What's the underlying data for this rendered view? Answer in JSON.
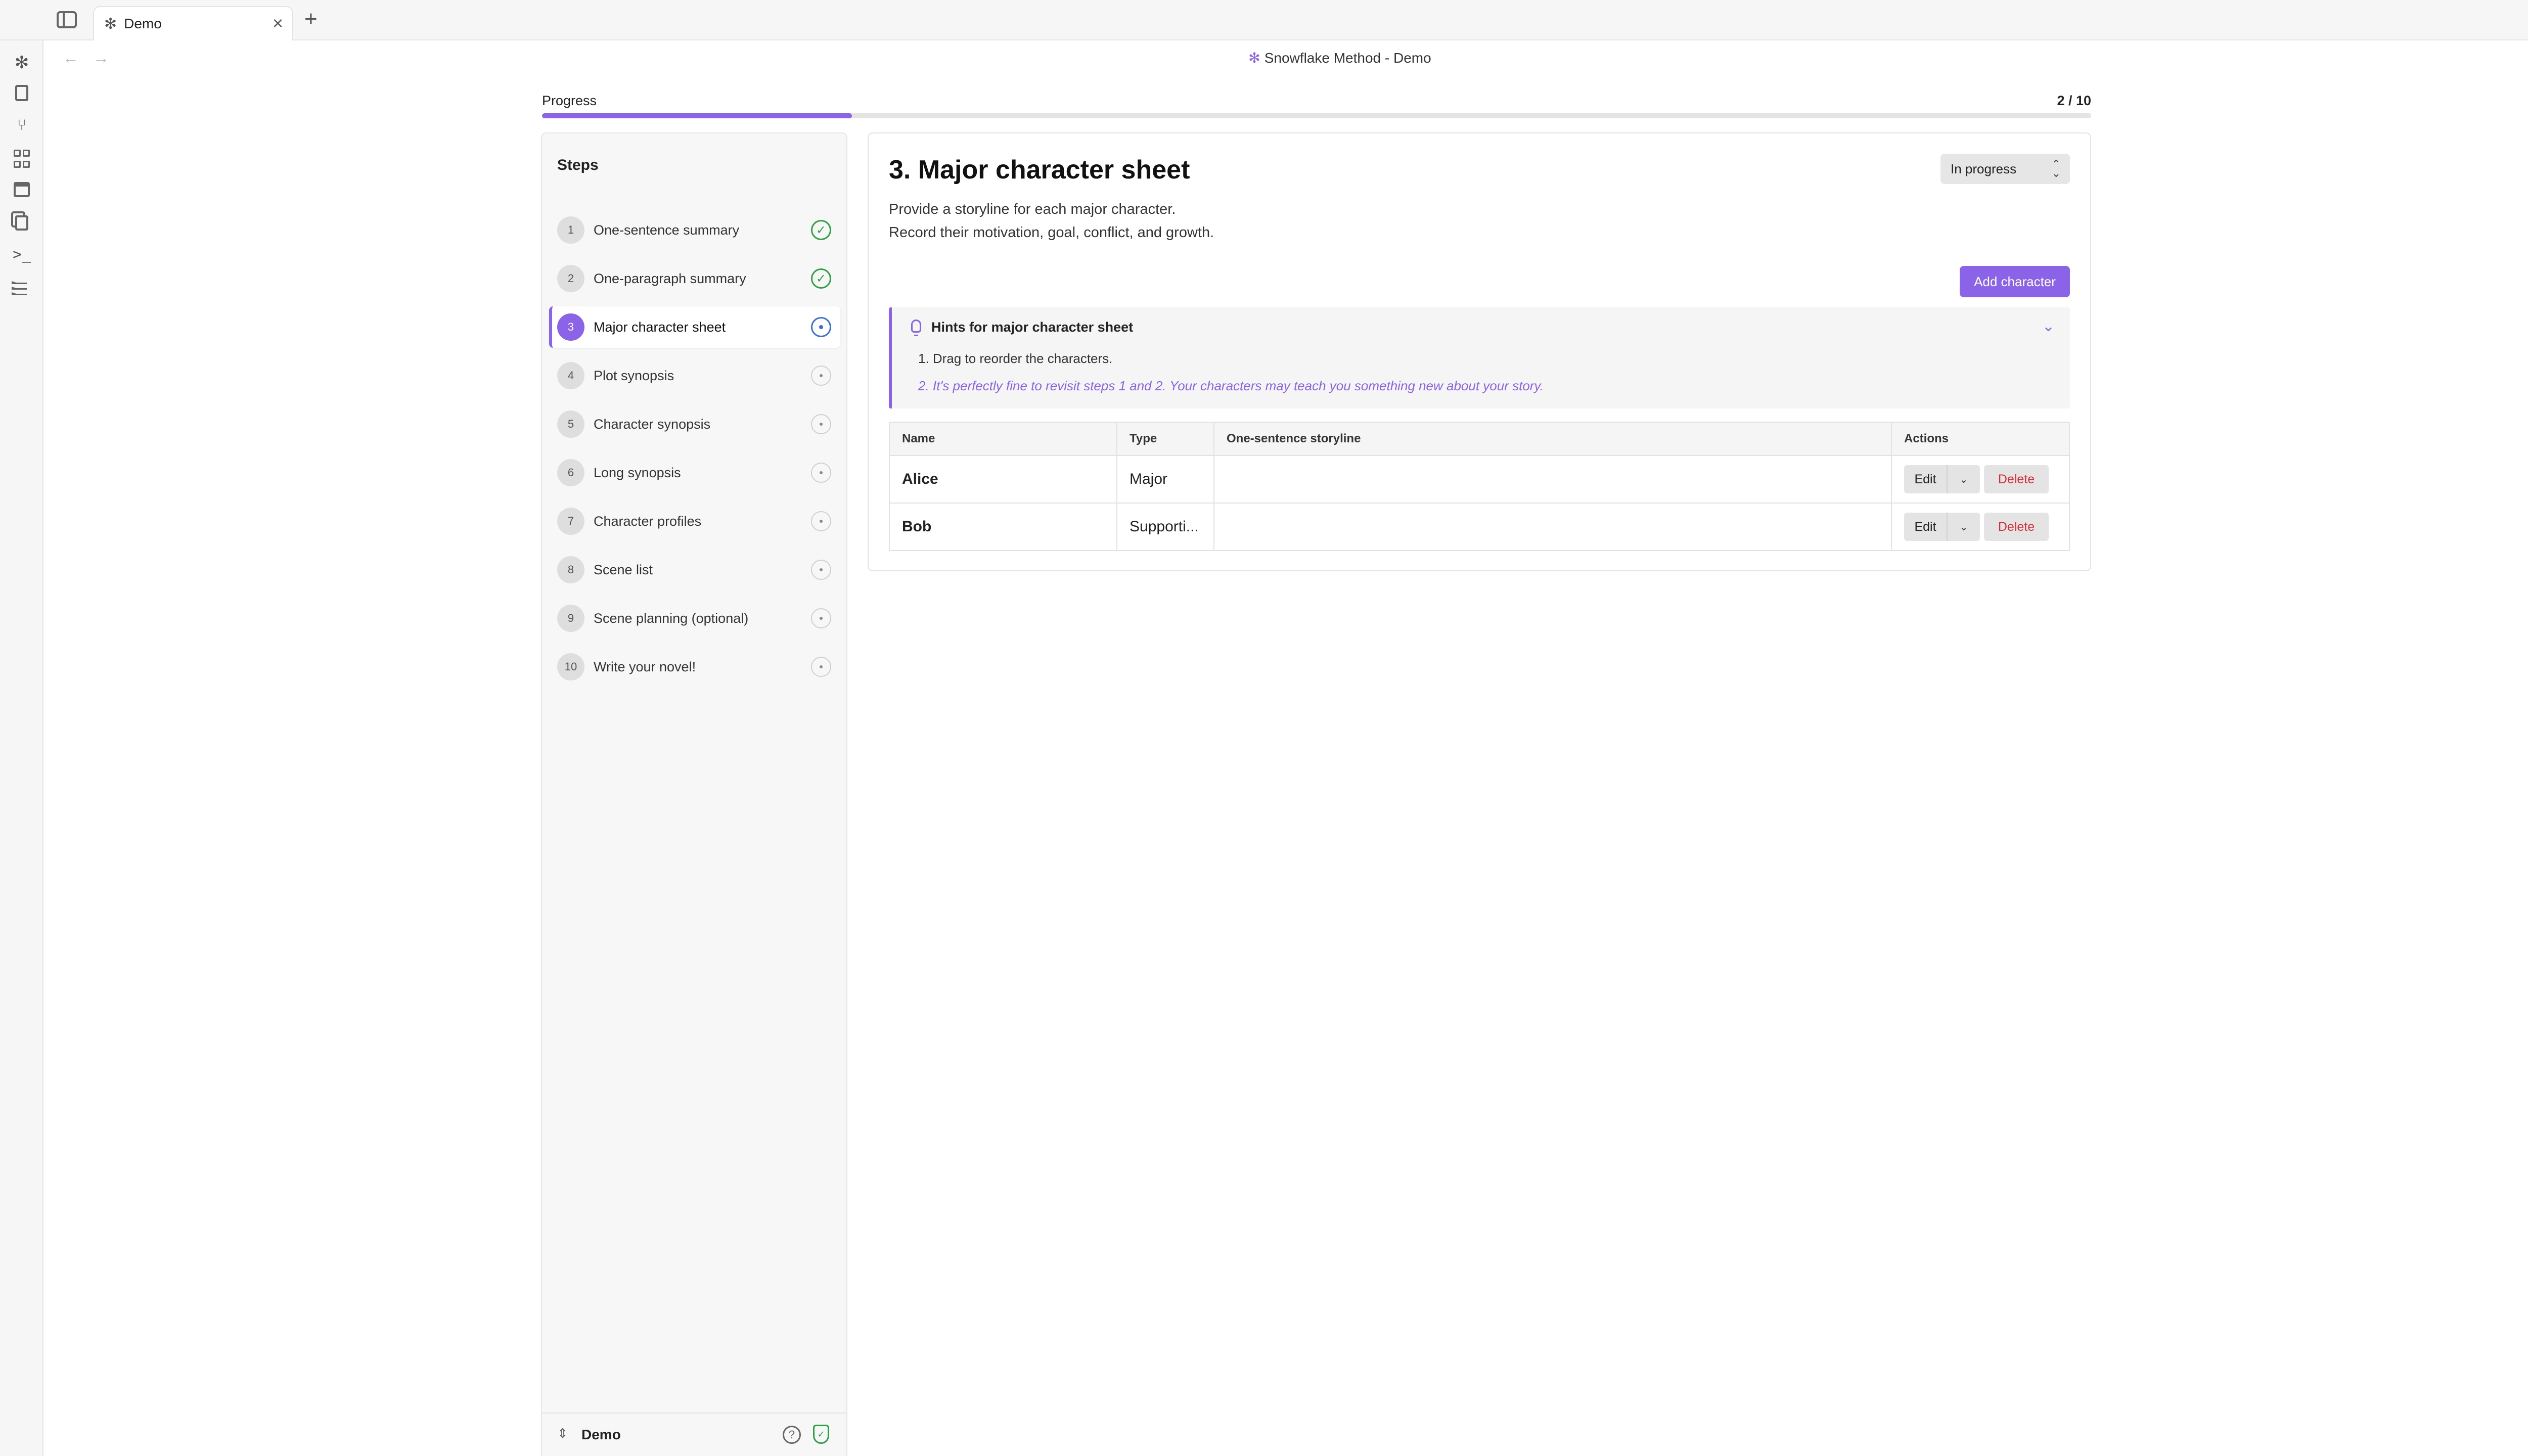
{
  "tabs": [
    {
      "label": "Demo",
      "icon": "snowflake-icon"
    }
  ],
  "header": {
    "title": "Snowflake Method - Demo"
  },
  "progress": {
    "label": "Progress",
    "count": "2 / 10",
    "completed": 2,
    "total": 10
  },
  "steps": {
    "title": "Steps",
    "items": [
      {
        "num": "1",
        "label": "One-sentence summary",
        "status": "done"
      },
      {
        "num": "2",
        "label": "One-paragraph summary",
        "status": "done"
      },
      {
        "num": "3",
        "label": "Major character sheet",
        "status": "current"
      },
      {
        "num": "4",
        "label": "Plot synopsis",
        "status": "pending"
      },
      {
        "num": "5",
        "label": "Character synopsis",
        "status": "pending"
      },
      {
        "num": "6",
        "label": "Long synopsis",
        "status": "pending"
      },
      {
        "num": "7",
        "label": "Character profiles",
        "status": "pending"
      },
      {
        "num": "8",
        "label": "Scene list",
        "status": "pending"
      },
      {
        "num": "9",
        "label": "Scene planning (optional)",
        "status": "pending"
      },
      {
        "num": "10",
        "label": "Write your novel!",
        "status": "pending"
      }
    ]
  },
  "vault": {
    "name": "Demo"
  },
  "main": {
    "heading": "3. Major character sheet",
    "status_value": "In progress",
    "description_lines": [
      "Provide a storyline for each major character.",
      "Record their motivation, goal, conflict, and growth."
    ],
    "add_button": "Add character",
    "hints": {
      "title": "Hints for major character sheet",
      "items": [
        "1.  Drag to reorder the characters.",
        "2.  It's perfectly fine to revisit steps 1 and 2. Your characters may teach you something new about your story."
      ]
    },
    "table": {
      "headers": [
        "Name",
        "Type",
        "One-sentence storyline",
        "Actions"
      ],
      "rows": [
        {
          "name": "Alice",
          "type": "Major",
          "storyline": ""
        },
        {
          "name": "Bob",
          "type": "Supporti...",
          "storyline": ""
        }
      ],
      "edit_label": "Edit",
      "delete_label": "Delete"
    }
  },
  "colors": {
    "accent": "#8a63e8",
    "done": "#2ea043",
    "current": "#3b6fd6",
    "danger": "#d12f3a"
  }
}
